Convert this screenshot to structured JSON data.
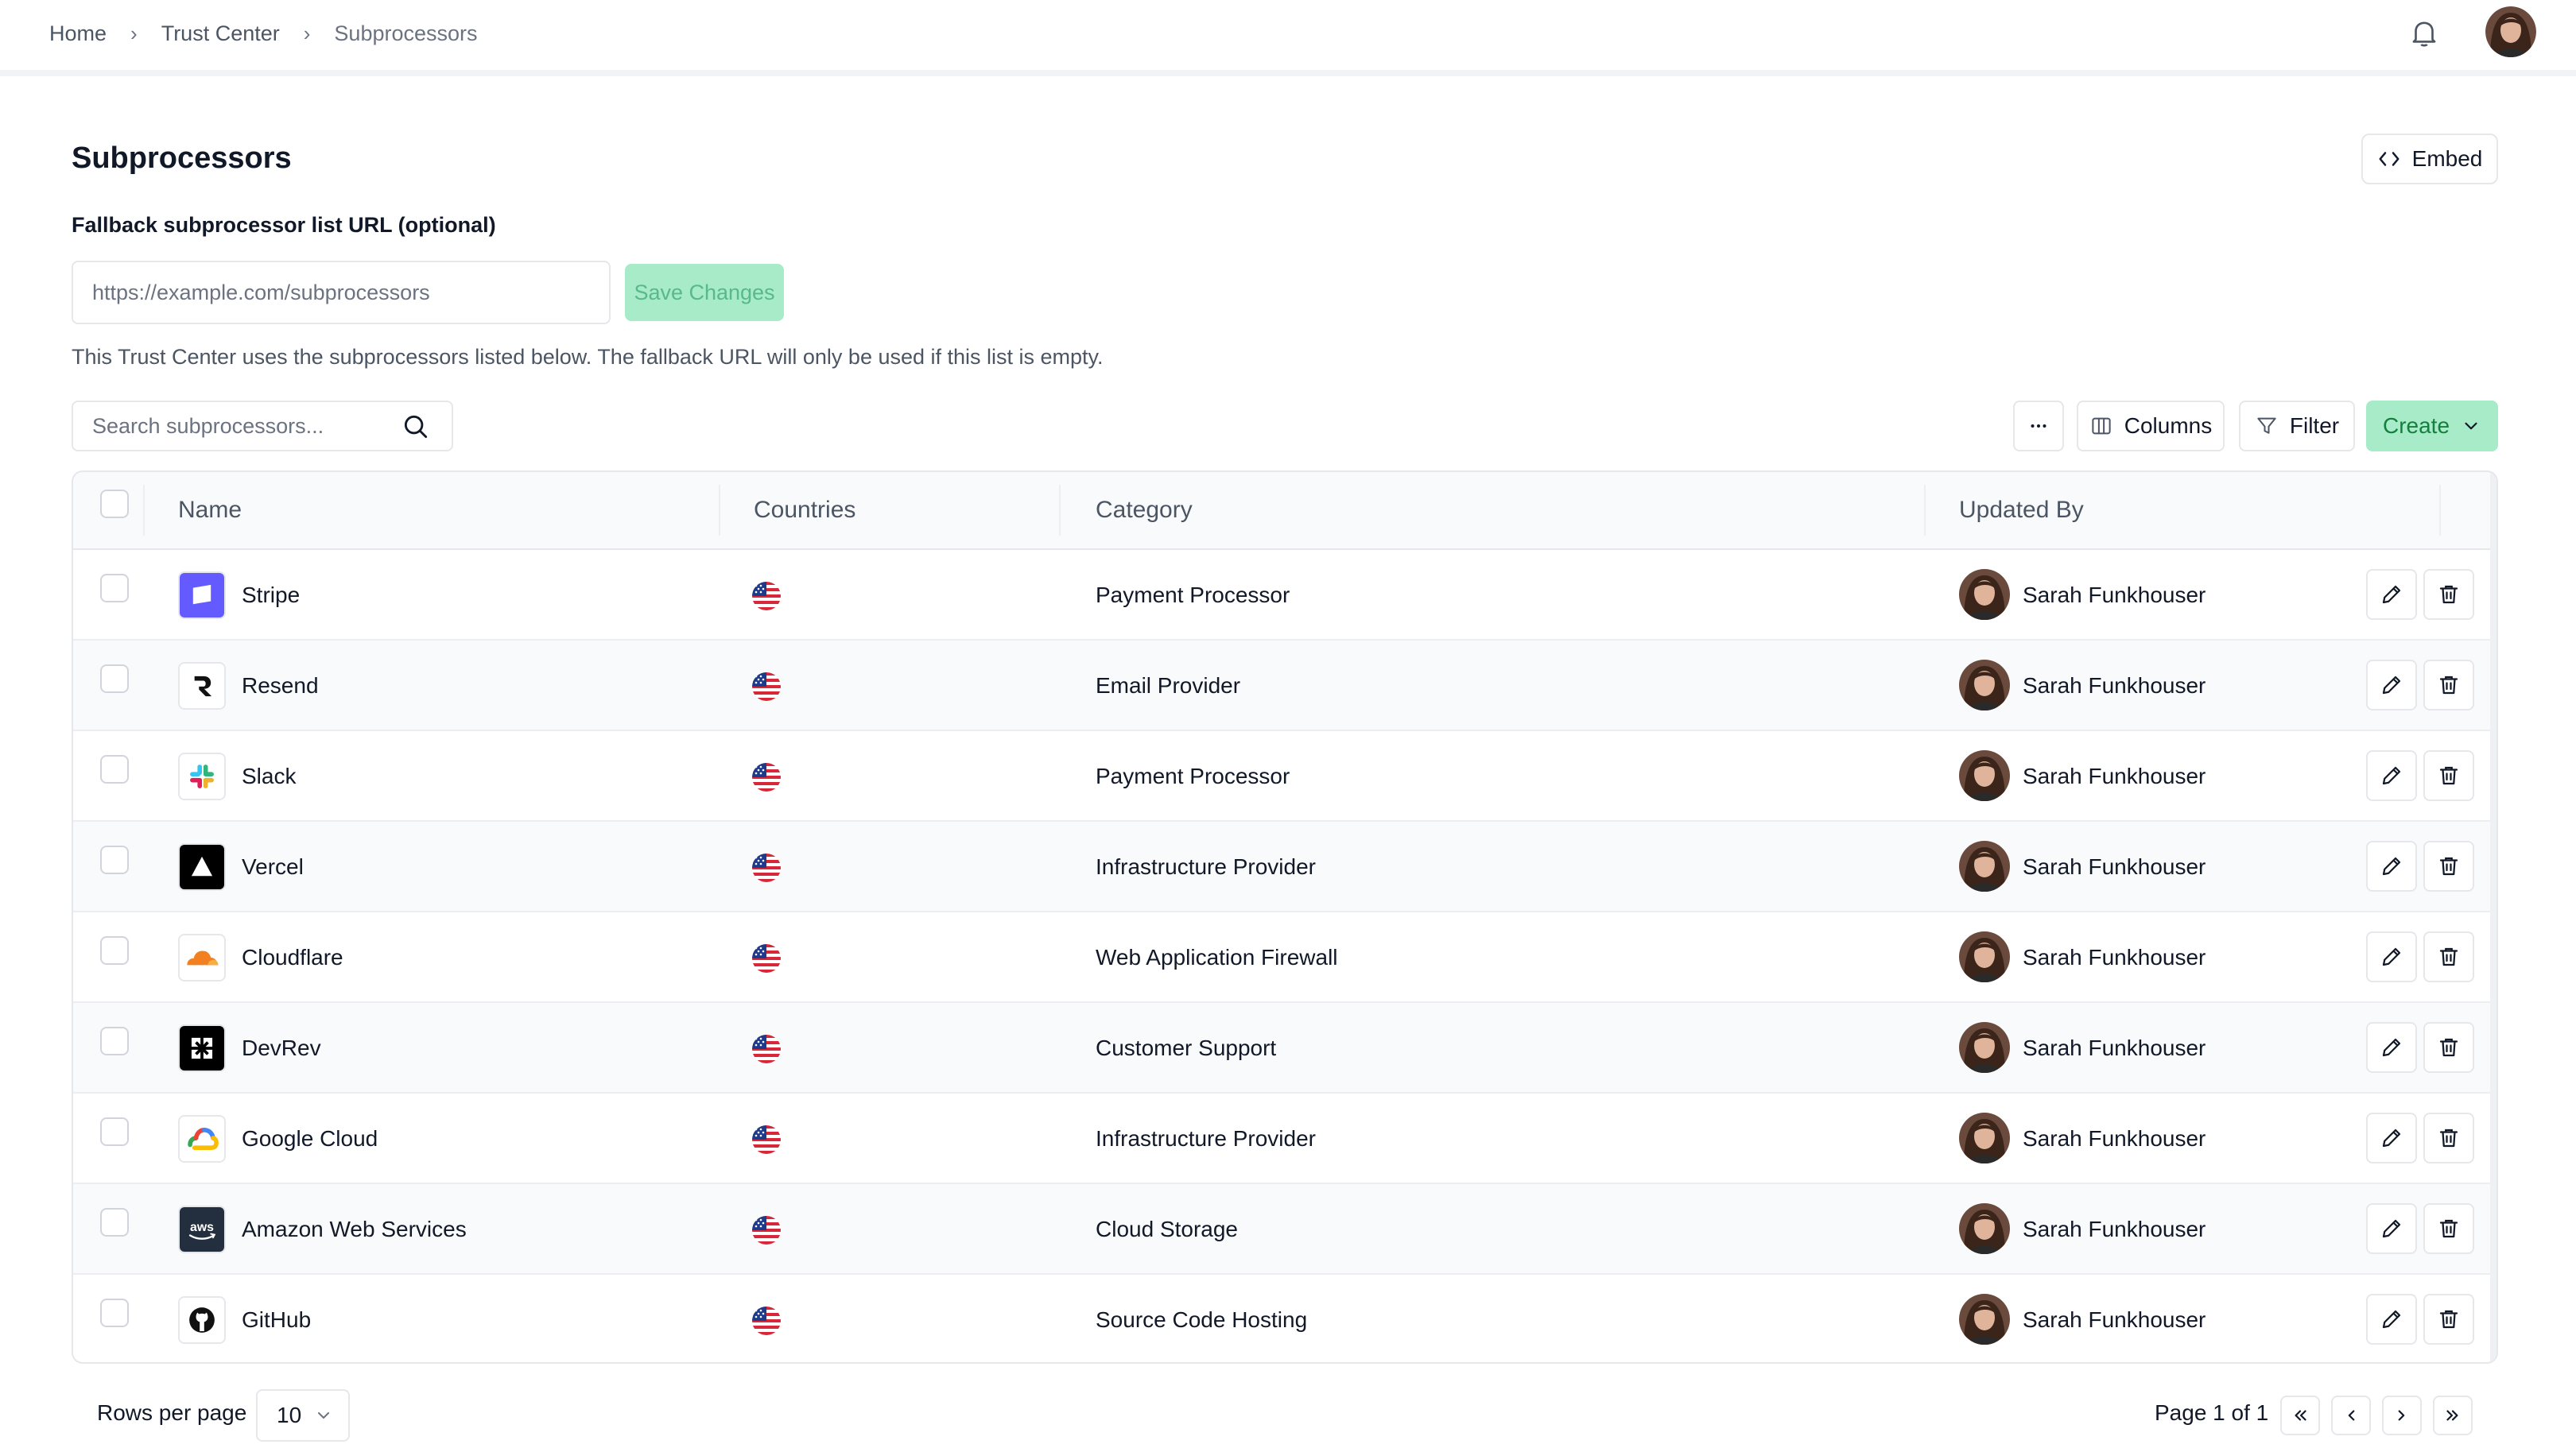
{
  "breadcrumb": [
    "Home",
    "Trust Center",
    "Subprocessors"
  ],
  "header": {
    "title": "Subprocessors",
    "embed_label": "Embed"
  },
  "fallback": {
    "label": "Fallback subprocessor list URL (optional)",
    "placeholder": "https://example.com/subprocessors",
    "value": "",
    "save_label": "Save Changes",
    "info": "This Trust Center uses the subprocessors listed below. The fallback URL will only be used if this list is empty."
  },
  "toolbar": {
    "search_placeholder": "Search subprocessors...",
    "columns_label": "Columns",
    "filter_label": "Filter",
    "create_label": "Create"
  },
  "table": {
    "headers": [
      "Name",
      "Countries",
      "Category",
      "Updated By"
    ],
    "rows": [
      {
        "name": "Stripe",
        "logo": "stripe-logo",
        "country": "United States",
        "category": "Payment Processor",
        "updated_by": "Sarah Funkhouser"
      },
      {
        "name": "Resend",
        "logo": "resend-logo",
        "country": "United States",
        "category": "Email Provider",
        "updated_by": "Sarah Funkhouser"
      },
      {
        "name": "Slack",
        "logo": "slack-logo",
        "country": "United States",
        "category": "Payment Processor",
        "updated_by": "Sarah Funkhouser"
      },
      {
        "name": "Vercel",
        "logo": "vercel-logo",
        "country": "United States",
        "category": "Infrastructure Provider",
        "updated_by": "Sarah Funkhouser"
      },
      {
        "name": "Cloudflare",
        "logo": "cloudflare-logo",
        "country": "United States",
        "category": "Web Application Firewall",
        "updated_by": "Sarah Funkhouser"
      },
      {
        "name": "DevRev",
        "logo": "devrev-logo",
        "country": "United States",
        "category": "Customer Support",
        "updated_by": "Sarah Funkhouser"
      },
      {
        "name": "Google Cloud",
        "logo": "google-cloud-logo",
        "country": "United States",
        "category": "Infrastructure Provider",
        "updated_by": "Sarah Funkhouser"
      },
      {
        "name": "Amazon Web Services",
        "logo": "aws-logo",
        "country": "United States",
        "category": "Cloud Storage",
        "updated_by": "Sarah Funkhouser"
      },
      {
        "name": "GitHub",
        "logo": "github-logo",
        "country": "United States",
        "category": "Source Code Hosting",
        "updated_by": "Sarah Funkhouser"
      }
    ]
  },
  "pagination": {
    "rows_per_page_label": "Rows per page",
    "rows_per_page": "10",
    "page_info": "Page 1 of 1"
  },
  "colors": {
    "accent": "#a7ebc9",
    "accent_text": "#15803d",
    "border": "#e5e7eb"
  }
}
